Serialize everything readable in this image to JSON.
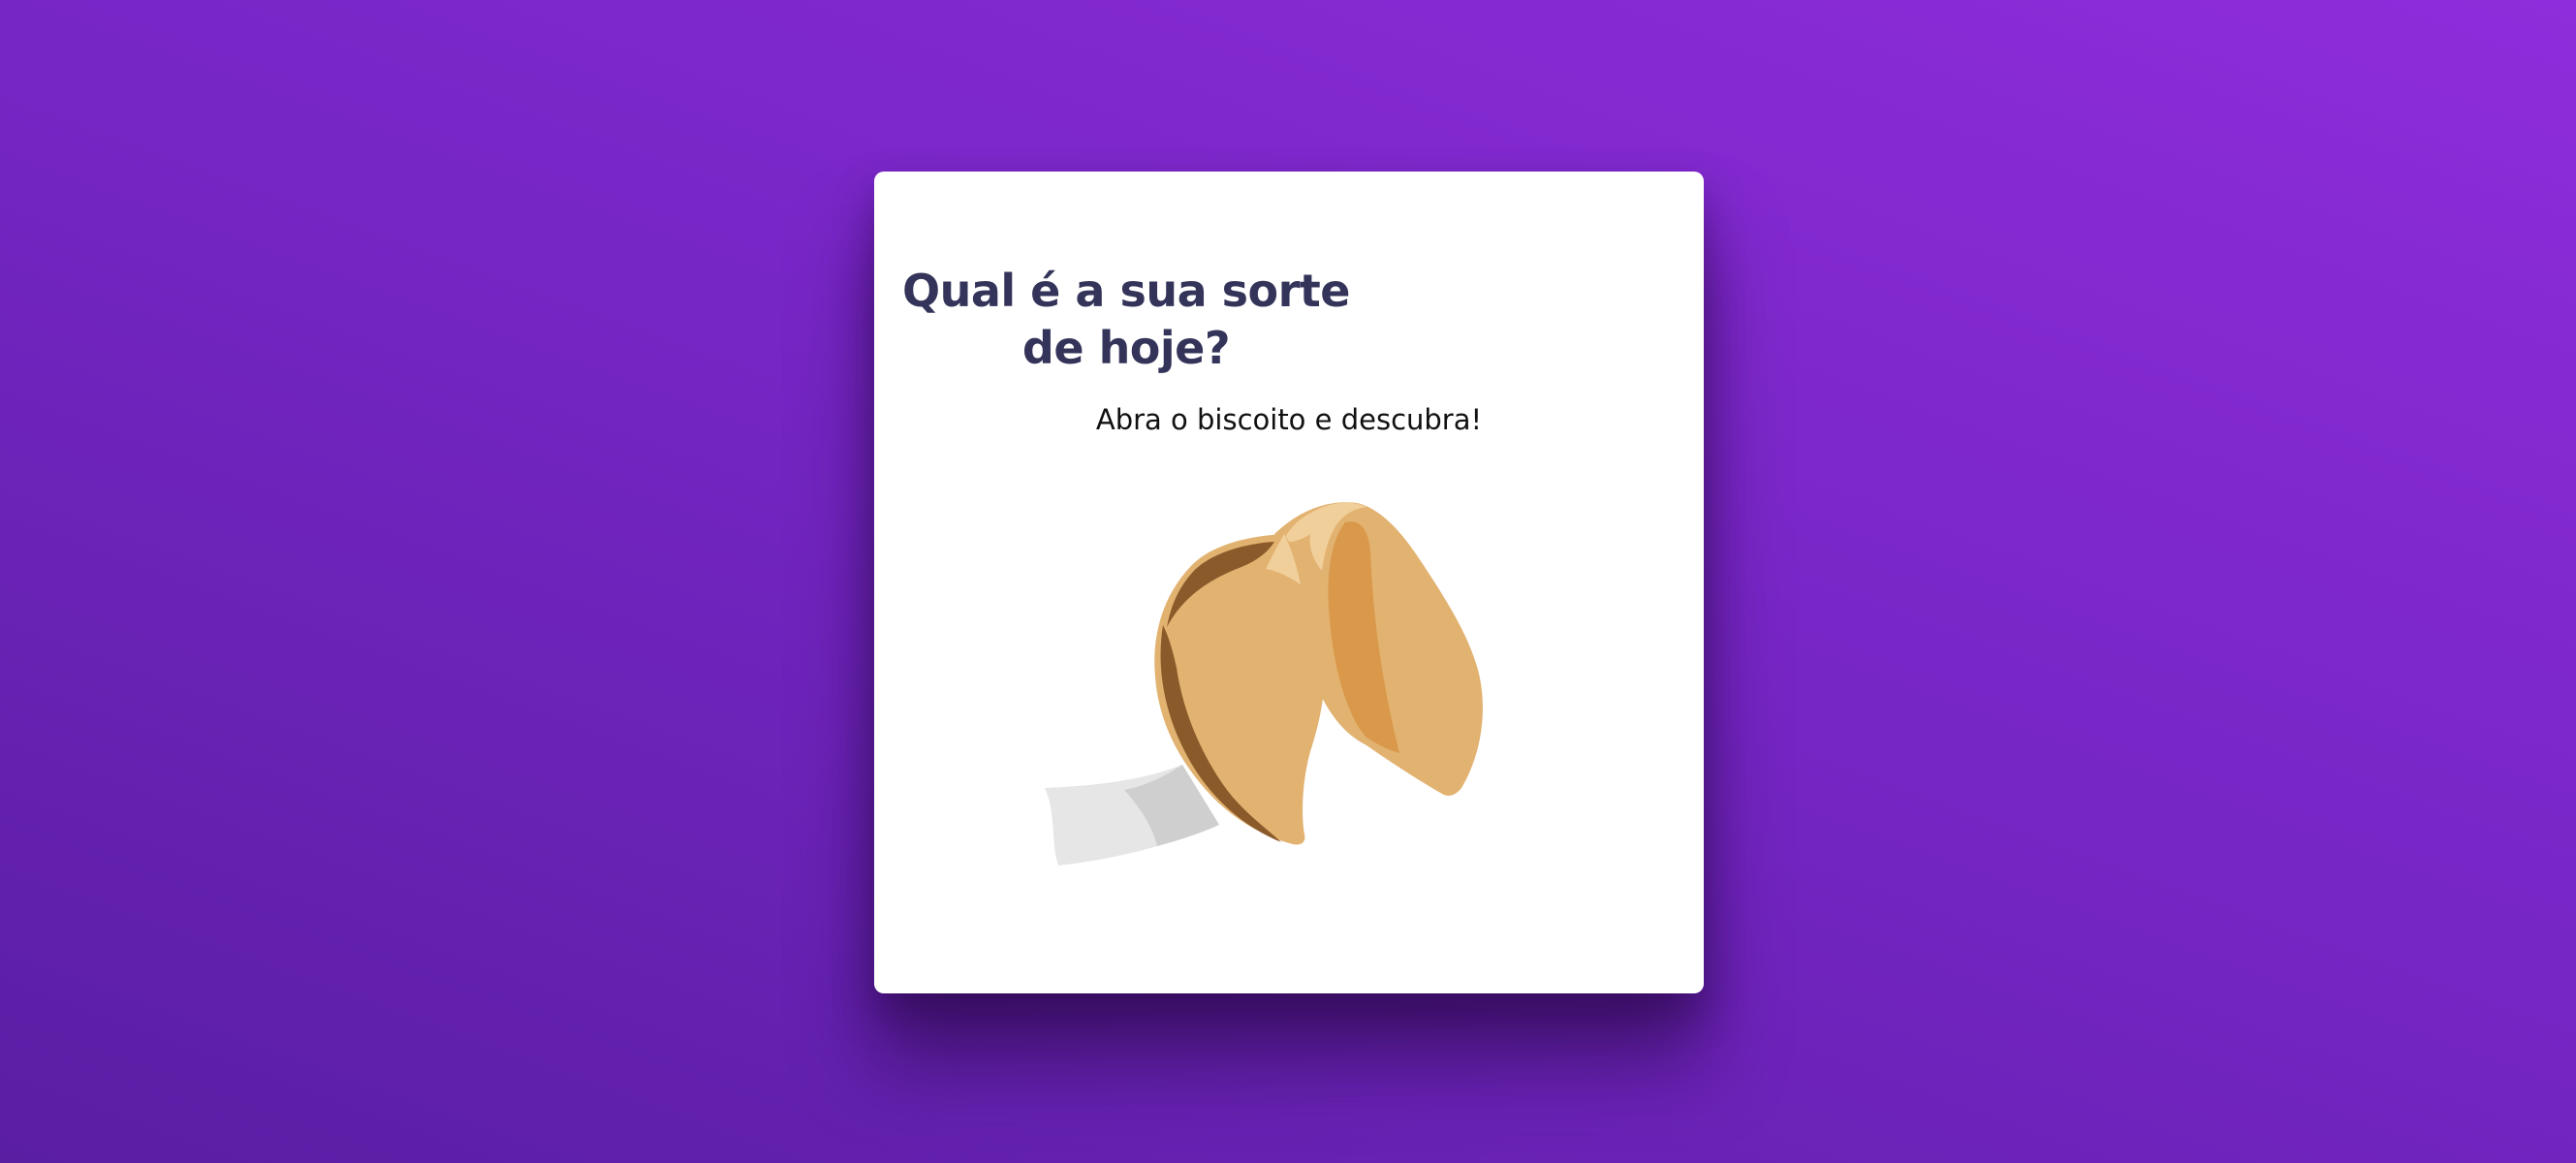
{
  "card": {
    "title": "Qual é a sua sorte de hoje?",
    "subtitle": "Abra o biscoito e descubra!"
  },
  "cookie": {
    "icon": "fortune-cookie-icon"
  },
  "colors": {
    "background_start": "#8e2ddb",
    "background_end": "#5a1ea3",
    "card": "#ffffff",
    "title": "#34345a",
    "cookie": "#e2b270",
    "cookie_shadow": "#8b5a2b",
    "cookie_inner": "#d9984a",
    "paper": "#e6e6e6"
  }
}
